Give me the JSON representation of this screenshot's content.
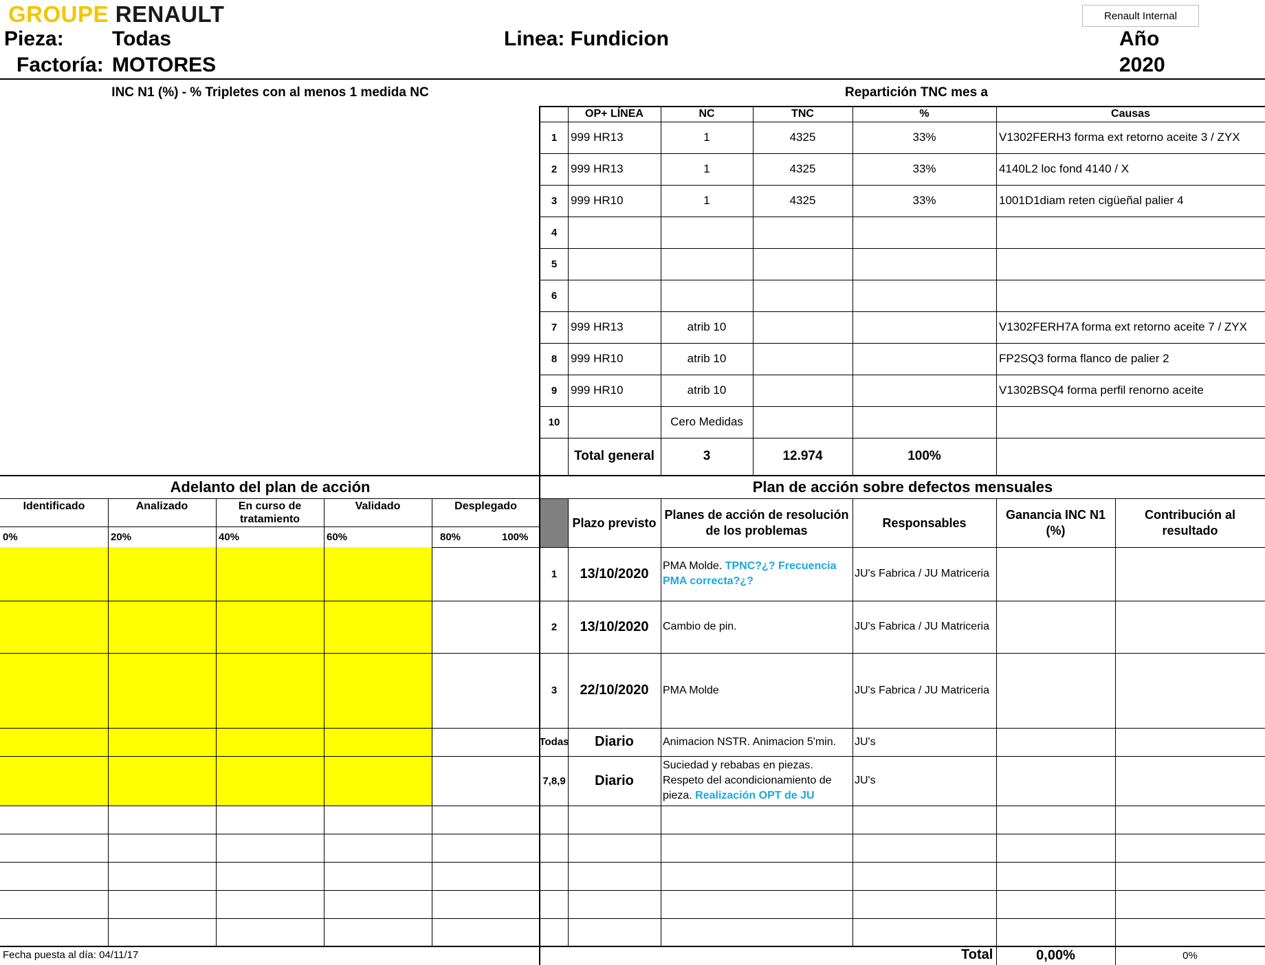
{
  "header": {
    "logo_groupe": "GROUPE",
    "logo_renault": "RENAULT",
    "internal_badge": "Renault Internal",
    "pieza_label": "Pieza:",
    "pieza_value": "Todas",
    "factoria_label": "Factoría:",
    "factoria_value": "MOTORES",
    "linea": "Linea: Fundicion",
    "anio_label": "Año",
    "anio_value": "2020"
  },
  "inc_panel": {
    "title": "INC N1 (%) - % Tripletes con al menos 1 medida NC"
  },
  "tnc": {
    "title": "Repartición TNC mes a",
    "headers": {
      "op": "OP+ LÍNEA",
      "nc": "NC",
      "tnc": "TNC",
      "pct": "%",
      "causas": "Causas"
    },
    "rows": [
      {
        "n": "1",
        "op": "999 HR13",
        "nc": "1",
        "tnc": "4325",
        "pct": "33%",
        "causa": "V1302FERH3 forma ext retorno aceite 3 / ZYX"
      },
      {
        "n": "2",
        "op": "999 HR13",
        "nc": "1",
        "tnc": "4325",
        "pct": "33%",
        "causa": "4140L2 loc fond 4140 / X"
      },
      {
        "n": "3",
        "op": "999 HR10",
        "nc": "1",
        "tnc": "4325",
        "pct": "33%",
        "causa": "1001D1diam reten cigüeñal palier 4"
      },
      {
        "n": "4",
        "op": "",
        "nc": "",
        "tnc": "",
        "pct": "",
        "causa": ""
      },
      {
        "n": "5",
        "op": "",
        "nc": "",
        "tnc": "",
        "pct": "",
        "causa": ""
      },
      {
        "n": "6",
        "op": "",
        "nc": "",
        "tnc": "",
        "pct": "",
        "causa": ""
      },
      {
        "n": "7",
        "op": "999 HR13",
        "nc": "atrib 10",
        "tnc": "",
        "pct": "",
        "causa": "V1302FERH7A forma ext retorno aceite 7 / ZYX"
      },
      {
        "n": "8",
        "op": "999 HR10",
        "nc": "atrib 10",
        "tnc": "",
        "pct": "",
        "causa": "FP2SQ3 forma flanco de palier 2"
      },
      {
        "n": "9",
        "op": "999 HR10",
        "nc": "atrib 10",
        "tnc": "",
        "pct": "",
        "causa": "V1302BSQ4 forma perfil renorno aceite"
      },
      {
        "n": "10",
        "op": "",
        "nc": "Cero Medidas",
        "tnc": "",
        "pct": "",
        "causa": ""
      }
    ],
    "total": {
      "label": "Total general",
      "nc": "3",
      "tnc": "12.974",
      "pct": "100%"
    }
  },
  "adelanto": {
    "title": "Adelanto del plan de acción",
    "stages": [
      "Identificado",
      "Analizado",
      "En curso de tratamiento",
      "Validado",
      "Desplegado"
    ],
    "scale": [
      "0%",
      "20%",
      "40%",
      "60%",
      "80%",
      "100%"
    ],
    "progress_fraction": [
      0.8,
      0.8,
      0.8,
      0.8,
      0.8
    ],
    "fill_color": "#ffff00"
  },
  "plan": {
    "title": "Plan de acción sobre defectos mensuales",
    "headers": {
      "plazo": "Plazo previsto",
      "planes": "Planes de acción de resolución de los problemas",
      "responsables": "Responsables",
      "ganancia": "Ganancia INC N1 (%)",
      "contribucion": "Contribución al resultado"
    },
    "rows": [
      {
        "n": "1",
        "plazo": "13/10/2020",
        "plan_a": "PMA Molde. ",
        "plan_b": "TPNC?¿? Frecuencia PMA correcta?¿?",
        "resp": "JU's Fabrica / JU Matriceria"
      },
      {
        "n": "2",
        "plazo": "13/10/2020",
        "plan_a": "Cambio de pin.",
        "plan_b": "",
        "resp": "JU's Fabrica / JU Matriceria"
      },
      {
        "n": "3",
        "plazo": "22/10/2020",
        "plan_a": "PMA Molde",
        "plan_b": "",
        "resp": "JU's Fabrica / JU Matriceria"
      },
      {
        "n": "Todas",
        "plazo": "Diario",
        "plan_a": "Animacion NSTR. Animacion 5'min.",
        "plan_b": "",
        "resp": "JU's"
      },
      {
        "n": "7,8,9",
        "plazo": "Diario",
        "plan_a": "Suciedad y rebabas en piezas. Respeto del acondicionamiento de pieza. ",
        "plan_b": "Realización OPT de JU",
        "resp": "JU's"
      }
    ],
    "total_label": "Total",
    "total_ganancia": "0,00%",
    "total_contrib": "0%"
  },
  "footer": {
    "fecha": "Fecha puesta al día: 04/11/17"
  }
}
